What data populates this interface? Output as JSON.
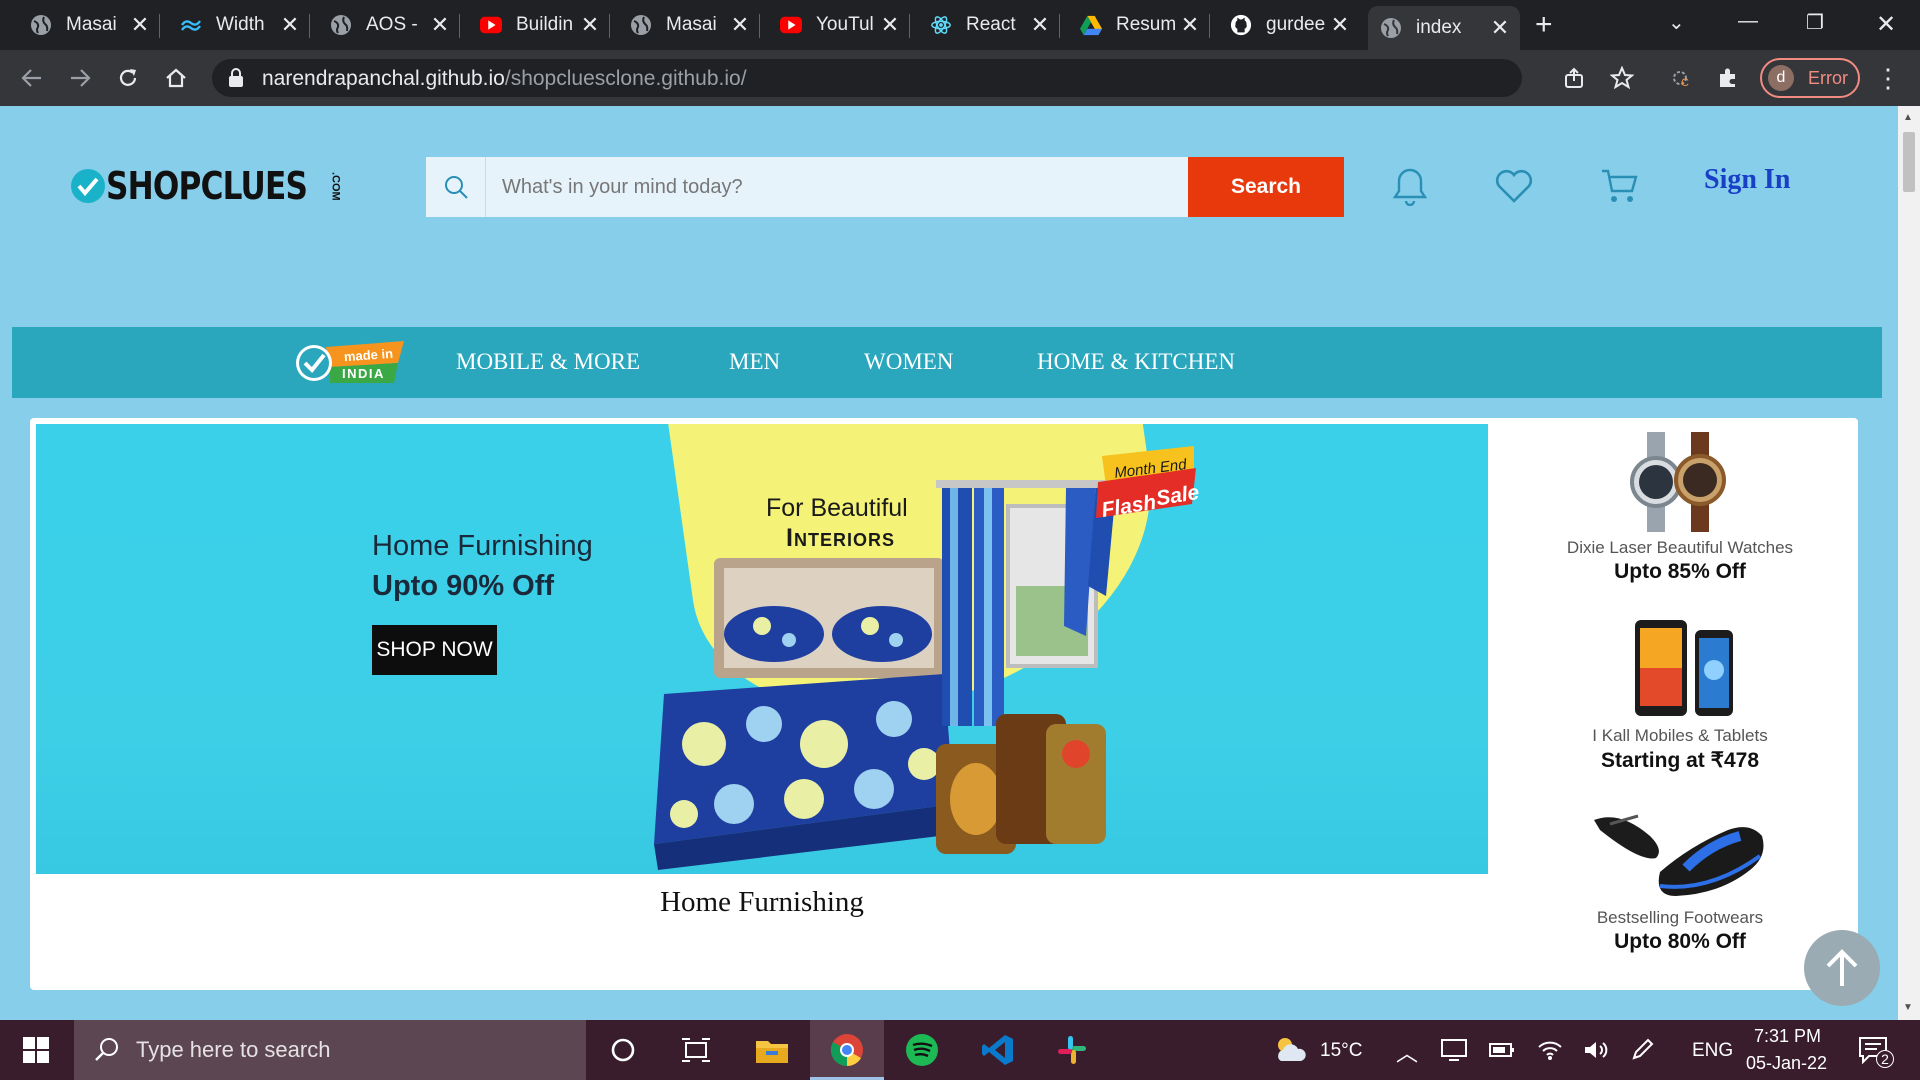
{
  "browser": {
    "tabs": [
      {
        "title": "Masai",
        "icon": "globe-icon"
      },
      {
        "title": "Width",
        "icon": "tailwind-icon"
      },
      {
        "title": "AOS -",
        "icon": "globe-icon"
      },
      {
        "title": "Buildin",
        "icon": "youtube-icon"
      },
      {
        "title": "Masai",
        "icon": "globe-icon"
      },
      {
        "title": "YouTul",
        "icon": "youtube-icon"
      },
      {
        "title": "React",
        "icon": "react-icon"
      },
      {
        "title": "Resum",
        "icon": "google-drive-icon"
      },
      {
        "title": "gurdee",
        "icon": "github-icon"
      },
      {
        "title": "index",
        "icon": "globe-icon",
        "active": true
      }
    ],
    "url_host": "narendrapanchal.github.io",
    "url_path": "/shopcluesclone.github.io/",
    "profile_initial": "d",
    "profile_status": "Error"
  },
  "header": {
    "logo_text": "SHOPCLUES",
    "logo_suffix": ".COM",
    "search_placeholder": "What's in your mind today?",
    "search_button": "Search",
    "sign_in": "Sign In"
  },
  "nav": {
    "badge_top": "made in",
    "badge_bottom": "INDIA",
    "items": [
      "MOBILE & MORE",
      "MEN",
      "WOMEN",
      "HOME & KITCHEN"
    ]
  },
  "banner": {
    "title": "Home Furnishing",
    "offer": "Upto 90% Off",
    "cta": "SHOP NOW",
    "tag_line1": "For Beautiful",
    "tag_line2": "Interiors",
    "flash_line1": "Month End",
    "flash_line2": "Flash",
    "flash_line3": "Sale",
    "caption": "Home Furnishing"
  },
  "side_deals": [
    {
      "name": "Dixie Laser Beautiful Watches",
      "offer": "Upto 85% Off"
    },
    {
      "name": "I Kall Mobiles & Tablets",
      "offer": "Starting at ₹478"
    },
    {
      "name": "Bestselling Footwears",
      "offer": "Upto 80% Off"
    }
  ],
  "taskbar": {
    "search_placeholder": "Type here to search",
    "weather": "15°C",
    "language": "ENG",
    "time": "7:31 PM",
    "date": "05-Jan-22",
    "notifications": "2"
  },
  "colors": {
    "page_bg": "#87ceeb",
    "nav_bg": "#2aa7bd",
    "search_button": "#e8390d",
    "sign_in": "#1a3fc7"
  }
}
